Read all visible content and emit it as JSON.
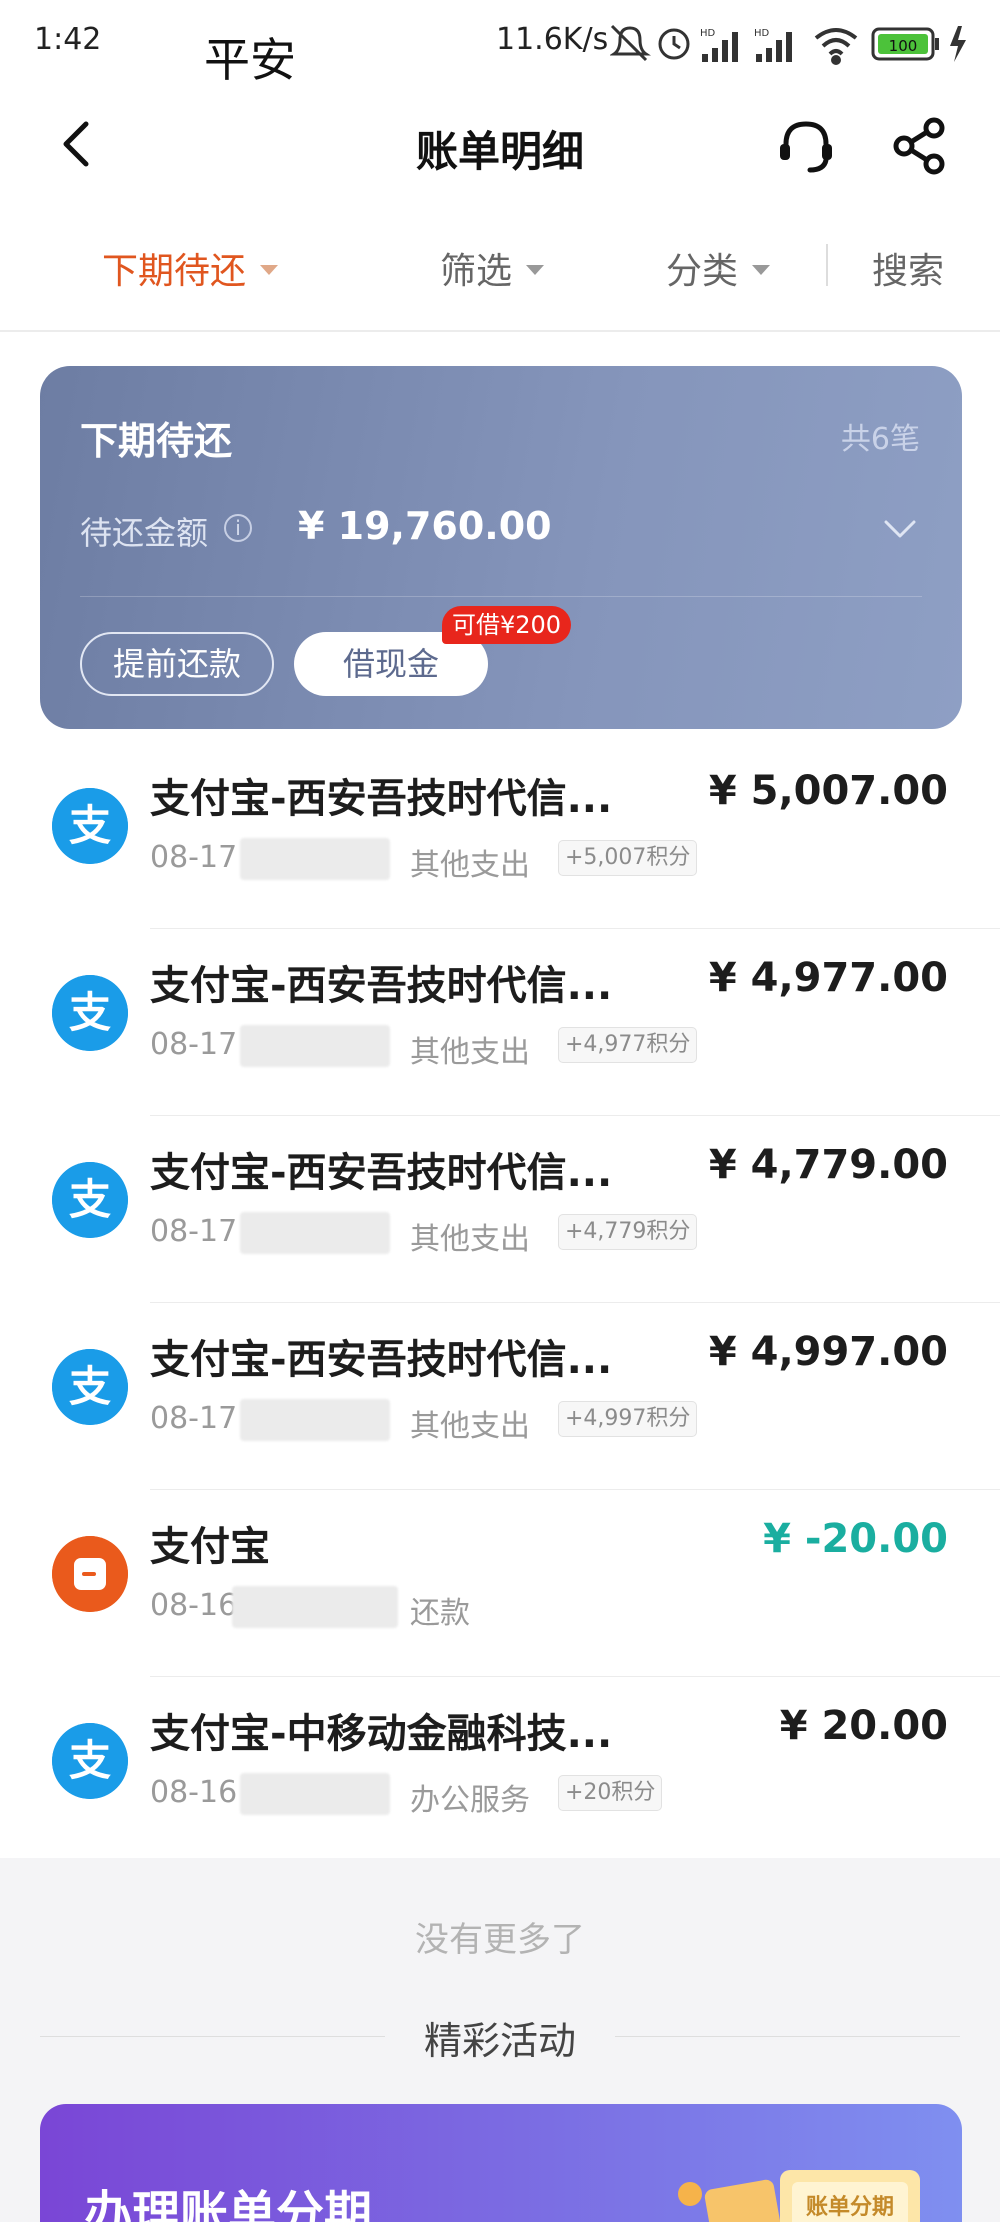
{
  "status_bar": {
    "time": "1:42",
    "carrier": "平安",
    "network_speed": "11.6K/s",
    "battery": "100"
  },
  "nav": {
    "title": "账单明细"
  },
  "filters": [
    {
      "label": "下期待还",
      "active": true
    },
    {
      "label": "筛选",
      "active": false
    },
    {
      "label": "分类",
      "active": false
    }
  ],
  "search_label": "搜索",
  "summary": {
    "title": "下期待还",
    "count": "共6笔",
    "amount_label": "待还金额",
    "amount": "¥ 19,760.00",
    "prepay_button": "提前还款",
    "cash_button": "借现金",
    "borrow_badge": "可借¥200"
  },
  "transactions": [
    {
      "icon": "alipay-icon",
      "name": "支付宝-西安吾技时代信...",
      "amount": "¥ 5,007.00",
      "date": "08-17",
      "category": "其他支出",
      "points": "+5,007积分",
      "refund": false
    },
    {
      "icon": "alipay-icon",
      "name": "支付宝-西安吾技时代信...",
      "amount": "¥ 4,977.00",
      "date": "08-17",
      "category": "其他支出",
      "points": "+4,977积分",
      "refund": false
    },
    {
      "icon": "alipay-icon",
      "name": "支付宝-西安吾技时代信...",
      "amount": "¥ 4,779.00",
      "date": "08-17",
      "category": "其他支出",
      "points": "+4,779积分",
      "refund": false
    },
    {
      "icon": "alipay-icon",
      "name": "支付宝-西安吾技时代信...",
      "amount": "¥ 4,997.00",
      "date": "08-17",
      "category": "其他支出",
      "points": "+4,997积分",
      "refund": false
    },
    {
      "icon": "repayment-icon",
      "name": "支付宝",
      "amount": "¥ -20.00",
      "date": "08-16",
      "category": "还款",
      "points": "",
      "refund": true
    },
    {
      "icon": "alipay-icon",
      "name": "支付宝-中移动金融科技...",
      "amount": "¥ 20.00",
      "date": "08-16",
      "category": "办公服务",
      "points": "+20积分",
      "refund": false
    }
  ],
  "footer": {
    "no_more": "没有更多了",
    "events_title": "精彩活动",
    "promo_text": "办理账单分期",
    "promo_art_text": "账单分期"
  },
  "colors": {
    "accent": "#e0561f",
    "refund": "#1aaea0",
    "card": "#7b8bb1",
    "badge": "#e8261c",
    "alipay": "#1a9ce8"
  }
}
